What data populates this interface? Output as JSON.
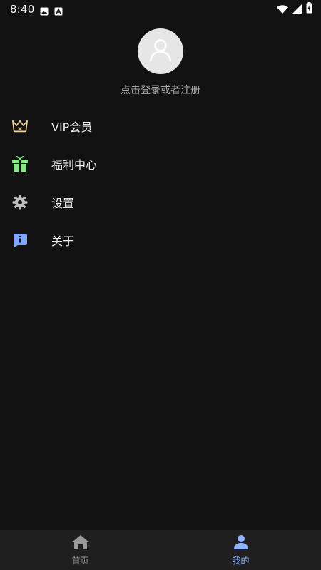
{
  "status_bar": {
    "time": "8:40",
    "icons": [
      "image-icon",
      "font-icon",
      "wifi-icon",
      "cellular-icon",
      "battery-icon"
    ]
  },
  "profile": {
    "login_text": "点击登录或者注册",
    "avatar_icon": "user-icon"
  },
  "menu": {
    "items": [
      {
        "label": "VIP会员",
        "icon": "crown-icon",
        "color": "#f3cf99"
      },
      {
        "label": "福利中心",
        "icon": "gift-icon",
        "color": "#8ce38c"
      },
      {
        "label": "设置",
        "icon": "gear-icon",
        "color": "#bfbfbf"
      },
      {
        "label": "关于",
        "icon": "info-icon",
        "color": "#7fa7ff"
      }
    ]
  },
  "bottom_nav": {
    "items": [
      {
        "label": "首页",
        "icon": "home-icon",
        "active": false
      },
      {
        "label": "我的",
        "icon": "person-icon",
        "active": true
      }
    ],
    "active_color": "#8fb3ff",
    "inactive_color": "#9a9a9a"
  }
}
